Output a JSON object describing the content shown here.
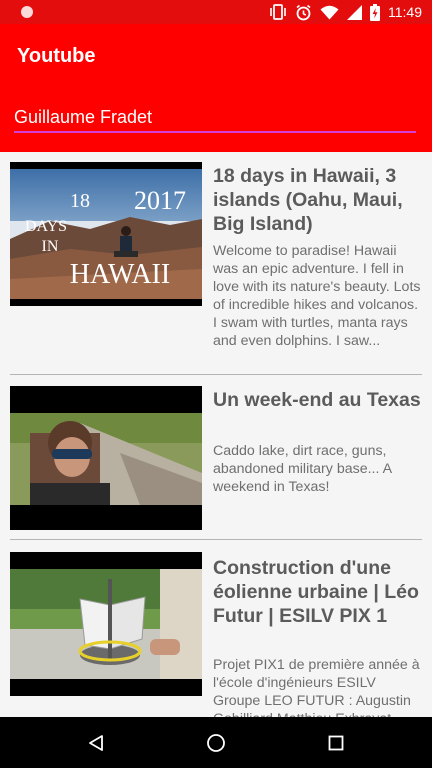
{
  "status_bar": {
    "time": "11:49",
    "icons": [
      "notification-dot",
      "vibrate-icon",
      "alarm-icon",
      "wifi-icon",
      "signal-icon",
      "battery-charging-icon"
    ]
  },
  "app_bar": {
    "title": "Youtube"
  },
  "search": {
    "value": "Guillaume Fradet",
    "accent_color": "#d63fd6"
  },
  "videos": [
    {
      "title": "18 days in Hawaii, 3 islands (Oahu, Maui, Big Island)",
      "description": "Welcome to paradise! Hawaii was an epic adventure. I fell in love with its nature's beauty. Lots of incredible hikes and volcanos. I swam with turtles, manta rays and even dolphins. I saw...",
      "thumbnail_text": [
        "18",
        "2017",
        "DAYS",
        "IN",
        "HAWAII"
      ]
    },
    {
      "title": "Un week-end au Texas",
      "description": "Caddo lake, dirt race, guns, abandoned military base... A weekend in Texas!"
    },
    {
      "title": "Construction d'une éolienne urbaine | Léo Futur | ESILV PIX 1",
      "description": "Projet PIX1 de première année à l'école d'ingénieurs ESILV Groupe LEO FUTUR : Augustin Gobilliard Matthieu Exbrayat"
    }
  ],
  "nav_bar": {
    "buttons": [
      "back-icon",
      "home-icon",
      "recents-icon"
    ]
  },
  "colors": {
    "status_bar": "#e30d0d",
    "app_bar": "#ff0000",
    "background": "#f5f5f5",
    "title_text": "#5b5b5b"
  }
}
